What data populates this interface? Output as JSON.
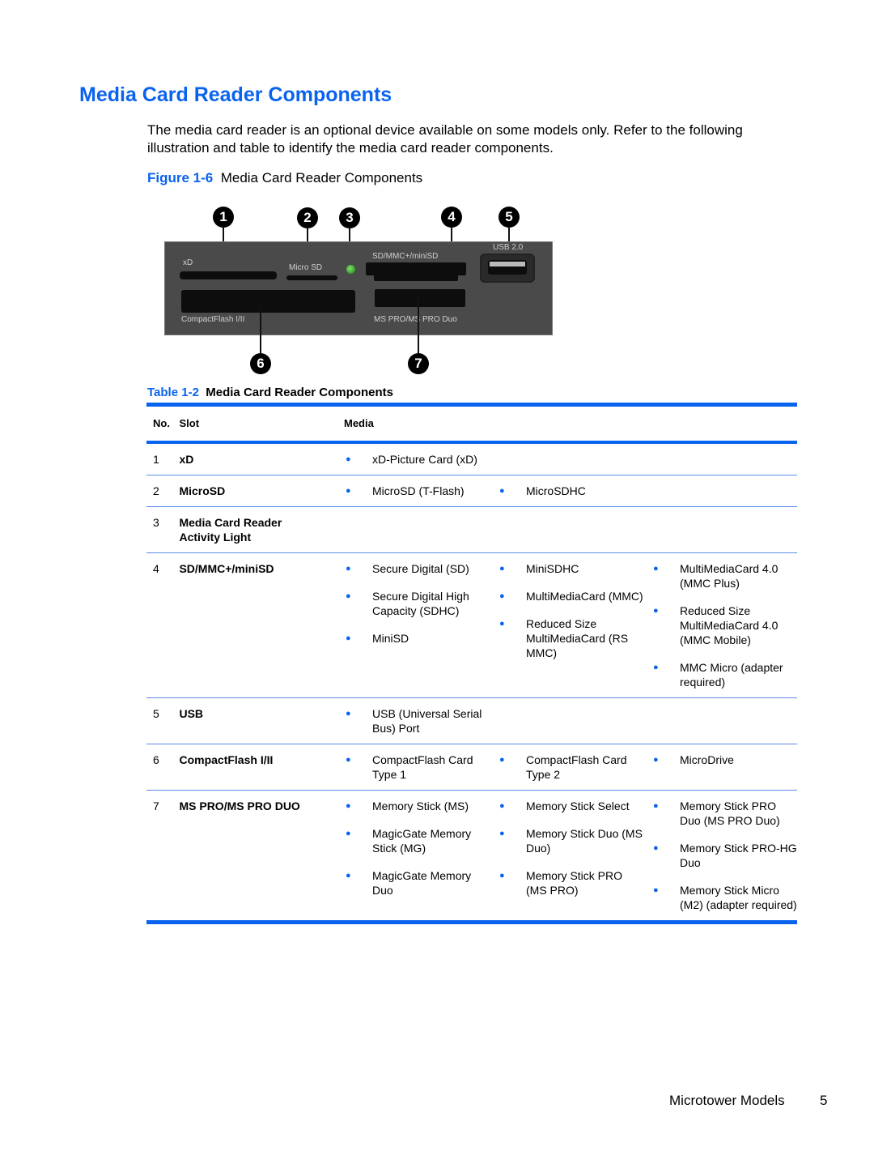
{
  "heading": "Media Card Reader Components",
  "intro": "The media card reader is an optional device available on some models only. Refer to the following illustration and table to identify the media card reader components.",
  "figure": {
    "number": "Figure 1-6",
    "caption": "Media Card Reader Components",
    "callouts": [
      "1",
      "2",
      "3",
      "4",
      "5",
      "6",
      "7"
    ],
    "labels": {
      "xd": "xD",
      "microsd": "Micro SD",
      "sdmmc": "SD/MMC+/miniSD",
      "usb": "USB 2.0",
      "cf": "CompactFlash I/II",
      "ms": "MS PRO/MS PRO Duo"
    },
    "led_color": "#3fae2a"
  },
  "table": {
    "number": "Table 1-2",
    "caption": "Media Card Reader Components",
    "headers": {
      "no": "No.",
      "slot": "Slot",
      "media": "Media"
    },
    "rows": [
      {
        "no": "1",
        "slot": "xD",
        "media": [
          [
            "xD-Picture Card (xD)"
          ],
          [],
          []
        ]
      },
      {
        "no": "2",
        "slot": "MicroSD",
        "media": [
          [
            "MicroSD (T-Flash)"
          ],
          [
            "MicroSDHC"
          ],
          []
        ]
      },
      {
        "no": "3",
        "slot": "Media Card Reader Activity Light",
        "media": [
          [],
          [],
          []
        ]
      },
      {
        "no": "4",
        "slot": "SD/MMC+/miniSD",
        "media": [
          [
            "Secure Digital (SD)",
            "Secure Digital High Capacity (SDHC)",
            "MiniSD"
          ],
          [
            "MiniSDHC",
            "MultiMediaCard (MMC)",
            "Reduced Size MultiMediaCard (RS MMC)"
          ],
          [
            "MultiMediaCard 4.0 (MMC Plus)",
            "Reduced Size MultiMediaCard 4.0 (MMC Mobile)",
            "MMC Micro (adapter required)"
          ]
        ]
      },
      {
        "no": "5",
        "slot": "USB",
        "media": [
          [
            "USB (Universal Serial Bus) Port"
          ],
          [],
          []
        ]
      },
      {
        "no": "6",
        "slot": "CompactFlash I/II",
        "media": [
          [
            "CompactFlash Card Type 1"
          ],
          [
            "CompactFlash Card Type 2"
          ],
          [
            "MicroDrive"
          ]
        ]
      },
      {
        "no": "7",
        "slot": "MS PRO/MS PRO DUO",
        "media": [
          [
            "Memory Stick (MS)",
            "MagicGate Memory Stick (MG)",
            "MagicGate Memory Duo"
          ],
          [
            "Memory Stick Select",
            "Memory Stick Duo (MS Duo)",
            "Memory Stick PRO (MS PRO)"
          ],
          [
            "Memory Stick PRO Duo (MS PRO Duo)",
            "Memory Stick PRO-HG Duo",
            "Memory Stick Micro (M2) (adapter required)"
          ]
        ]
      }
    ],
    "bullet_glyph": "●",
    "accent_color": "#0a63ee"
  },
  "footer": {
    "section": "Microtower Models",
    "page": "5"
  }
}
